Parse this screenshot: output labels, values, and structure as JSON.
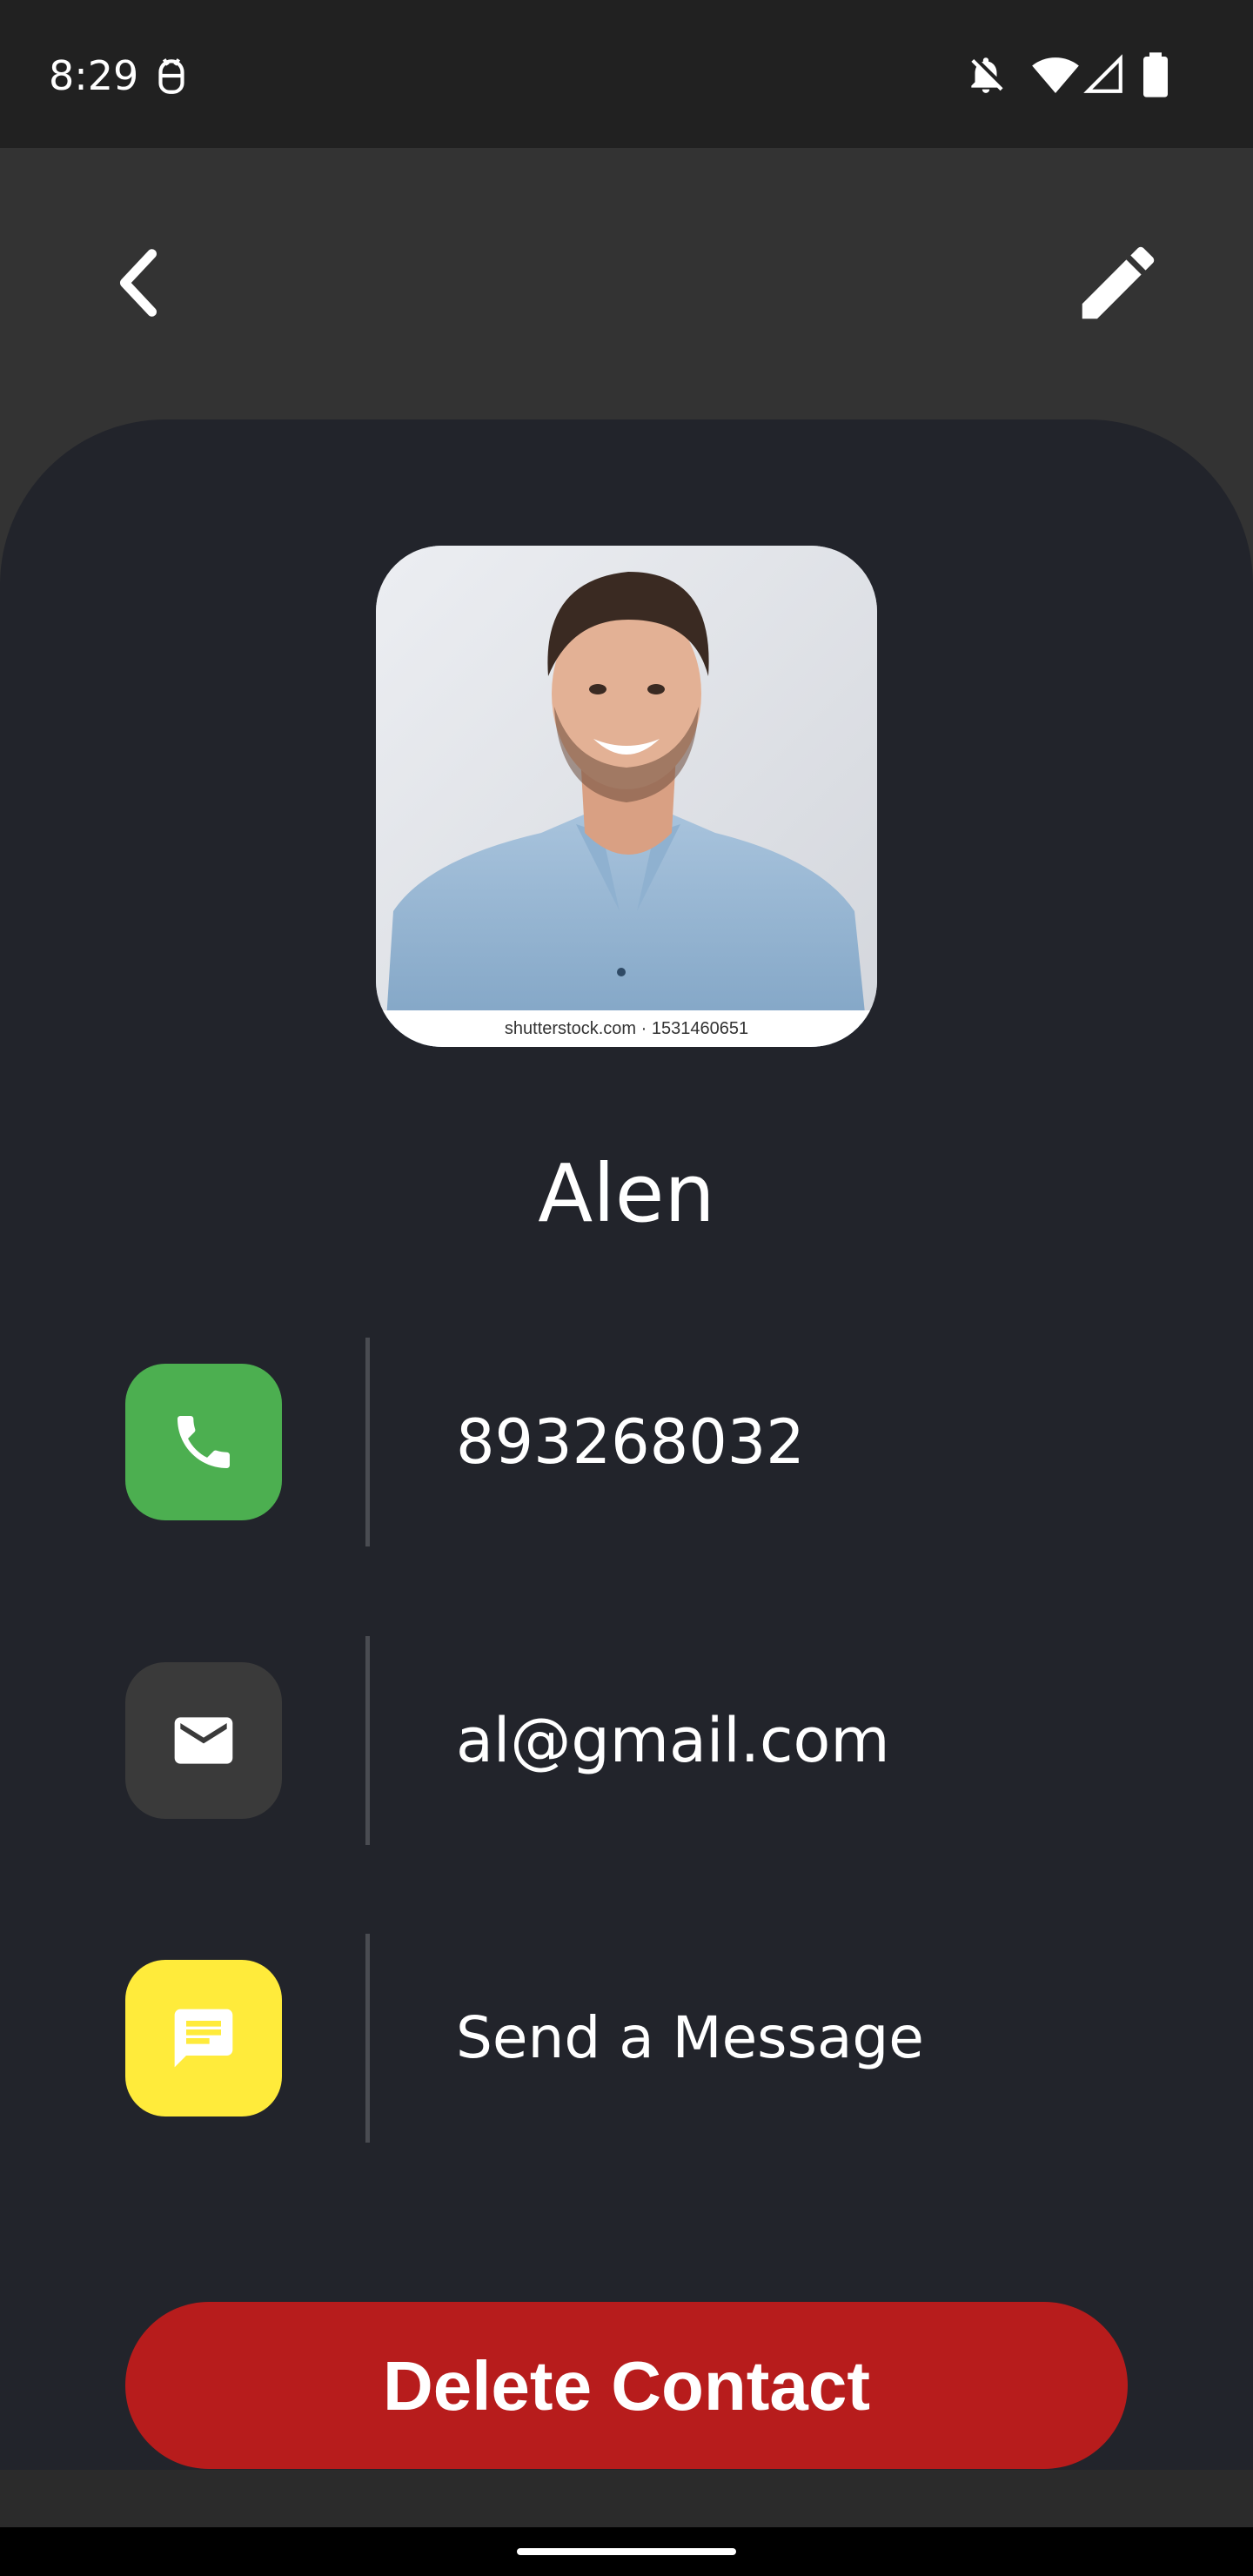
{
  "status_bar": {
    "time": "8:29"
  },
  "icons": {
    "status_app": "android-debug-icon",
    "status_dnd": "notifications-off-icon",
    "status_wifi": "wifi-icon",
    "status_signal": "signal-icon",
    "status_battery": "battery-icon",
    "back": "back-chevron-icon",
    "edit": "pencil-icon",
    "phone": "phone-icon",
    "email": "mail-icon",
    "message": "chat-icon"
  },
  "contact": {
    "photo_caption": "shutterstock.com · 1531460651",
    "name": "Alen",
    "phone": "893268032",
    "email": "al@gmail.com",
    "message_label": "Send a Message"
  },
  "actions": {
    "delete_label": "Delete Contact"
  },
  "colors": {
    "background": "#333333",
    "card": "#22242b",
    "phone_accent": "#4caf50",
    "email_accent": "#3a3a3a",
    "message_accent": "#ffeb3b",
    "delete": "#b71c1c"
  }
}
